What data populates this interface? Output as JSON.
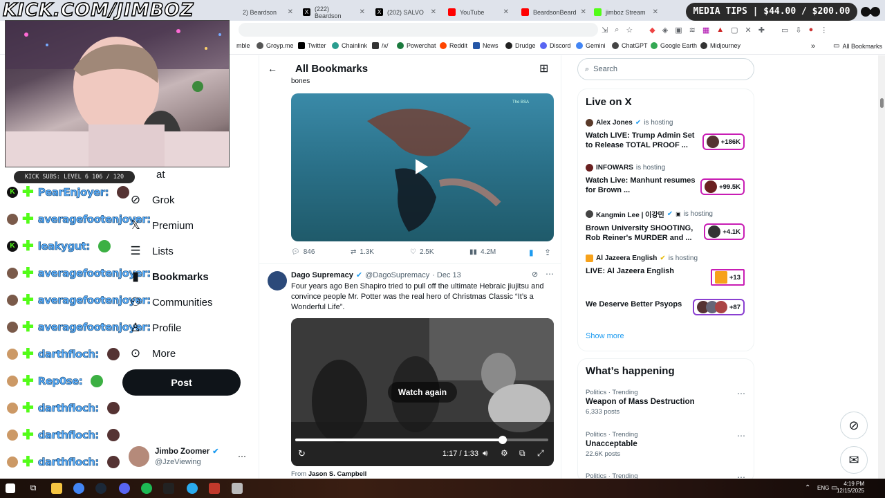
{
  "overlay": {
    "channel_url": "KICK.COM/JIMBOZ",
    "media_tips": "MEDIA TIPS | $44.00 / $200.00",
    "kick_subs": "KICK SUBS: LEVEL 6 106 / 120"
  },
  "chat": [
    {
      "name": "PearEnjoyer:",
      "badge": "K"
    },
    {
      "name": "averagefootenjoyer:",
      "badge": ""
    },
    {
      "name": "leakygut:",
      "badge": "K"
    },
    {
      "name": "averagefootenjoyer:",
      "badge": ""
    },
    {
      "name": "averagefootenjoyer:",
      "badge": ""
    },
    {
      "name": "averagefootenjoyer:",
      "badge": ""
    },
    {
      "name": "darthfloch:",
      "badge": ""
    },
    {
      "name": "Rep0se:",
      "badge": ""
    },
    {
      "name": "darthfloch:",
      "badge": ""
    },
    {
      "name": "darthfloch:",
      "badge": ""
    },
    {
      "name": "darthfloch:",
      "badge": ""
    }
  ],
  "tabs": [
    {
      "label": "2) Beardson",
      "color": "#ff0000"
    },
    {
      "label": "(222) Beardson",
      "color": "#000000"
    },
    {
      "label": "(202) SALVO",
      "color": "#000000"
    },
    {
      "label": "YouTube",
      "color": "#ff0000"
    },
    {
      "label": "BeardsonBeard",
      "color": "#ff0000"
    },
    {
      "label": "jimboz Stream",
      "color": "#53fc18"
    }
  ],
  "bookmarks_bar": [
    "mble",
    "Groyp.me",
    "Twitter",
    "Chainlink",
    "/x/",
    "Powerchat",
    "Reddit",
    "News",
    "Drudge",
    "Discord",
    "Gemini",
    "ChatGPT",
    "Google Earth",
    "Midjourney",
    "All Bookmarks"
  ],
  "x_nav": {
    "partial_label": "at",
    "items": [
      "Grok",
      "Premium",
      "Lists",
      "Bookmarks",
      "Communities",
      "Profile",
      "More"
    ],
    "post_label": "Post",
    "account_name": "Jimbo Zoomer",
    "account_handle": "@JzeViewing"
  },
  "center": {
    "header_title": "All Bookmarks",
    "prev_text": "bones",
    "video1_watermark": "The BSA",
    "stats": {
      "replies": "846",
      "reposts": "1.3K",
      "likes": "2.5K",
      "views": "4.2M"
    },
    "post": {
      "author": "Dago Supremacy",
      "handle": "@DagoSupremacy",
      "date": "· Dec 13",
      "text": "Four years ago Ben Shapiro tried to pull off the ultimate Hebraic jiujitsu and convince people Mr. Potter was the real hero of Christmas Classic “It’s a Wonderful Life”.",
      "watch_again": "Watch again",
      "time": "1:17 / 1:33",
      "progress": 0.82,
      "from_prefix": "From",
      "from_name": "Jason S. Campbell"
    }
  },
  "right": {
    "search_placeholder": "Search",
    "live_title": "Live on X",
    "hosts": [
      {
        "host": "Alex Jones",
        "status": "is hosting",
        "title": "Watch LIVE: Trump Admin Set to Release TOTAL PROOF ...",
        "count": "+186K"
      },
      {
        "host": "INFOWARS",
        "status": "is hosting",
        "title": "Watch Live: Manhunt resumes for Brown ...",
        "count": "+99.5K"
      },
      {
        "host": "Kangmin Lee | 이강민",
        "status": "is hosting",
        "title": "Brown University SHOOTING, Rob Reiner's MURDER and ...",
        "count": "+4.1K"
      },
      {
        "host": "Al Jazeera English",
        "status": "is hosting",
        "title": "LIVE: Al Jazeera English",
        "count": "+13"
      },
      {
        "host": "",
        "status": "",
        "title": "We Deserve Better Psyops",
        "count": "+87"
      }
    ],
    "show_more": "Show more",
    "happening_title": "What’s happening",
    "trends": [
      {
        "category": "Politics · Trending",
        "title": "Weapon of Mass Destruction",
        "posts": "6,333 posts"
      },
      {
        "category": "Politics · Trending",
        "title": "Unacceptable",
        "posts": "22.6K posts"
      },
      {
        "category": "Politics · Trending",
        "title": "",
        "posts": ""
      }
    ]
  },
  "taskbar": {
    "lang": "ENG",
    "time": "4:19 PM",
    "date": "12/15/2025"
  },
  "colors": {
    "verified": "#1d9bf0",
    "kick_green": "#53fc18",
    "live_ring": "#c81db4",
    "bookmark_blue": "#1d9bf0"
  }
}
